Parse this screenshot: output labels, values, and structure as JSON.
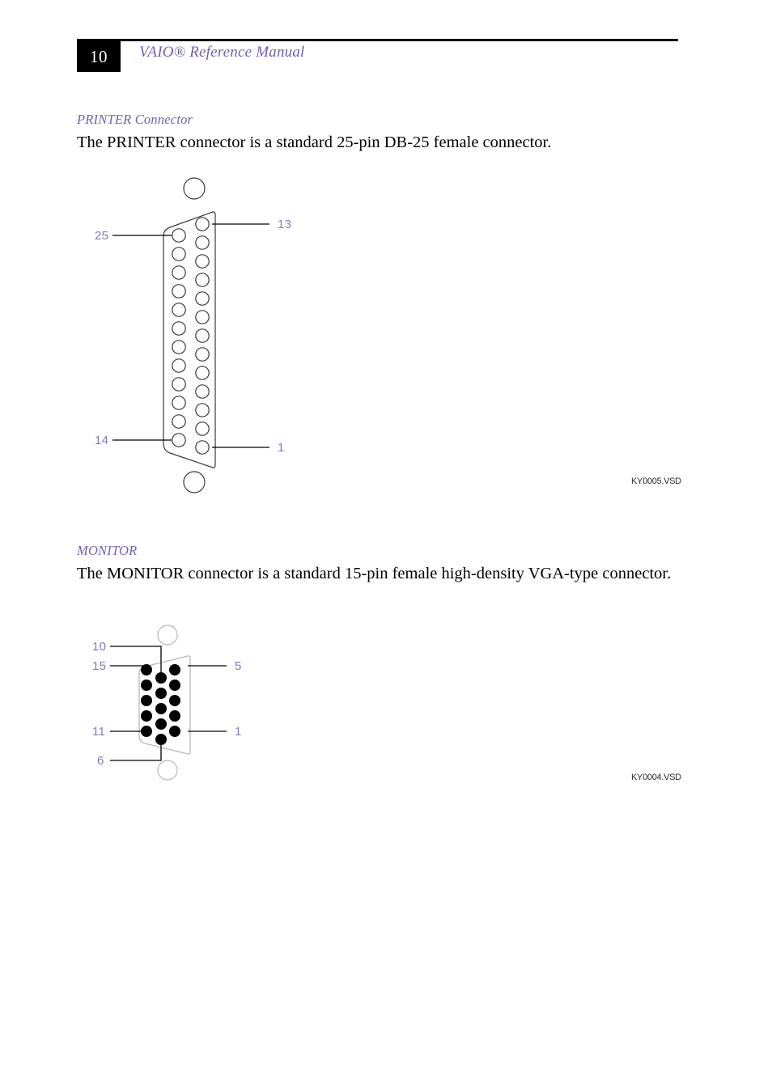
{
  "header": {
    "page_number": "10",
    "title": "VAIO® Reference Manual",
    "accent_color": "#6b63b5"
  },
  "sections": [
    {
      "id": "printer",
      "heading": "PRINTER Connector",
      "body": "The PRINTER connector is a standard 25-pin DB-25 female connector.",
      "figure": {
        "file_label": "KY0005.VSD",
        "connector_type": "DB-25 female",
        "pin_count": 25,
        "pin_style": "open-circle",
        "labels": {
          "top_left": "25",
          "top_right": "13",
          "bottom_left": "14",
          "bottom_right": "1"
        },
        "label_color": "#8079c0",
        "outline_color": "#3a3a3a"
      }
    },
    {
      "id": "monitor",
      "heading": "MONITOR",
      "body": "The MONITOR connector is a standard 15-pin female high-density VGA-type connector.",
      "figure": {
        "file_label": "KY0004.VSD",
        "connector_type": "HD-15 VGA female",
        "pin_count": 15,
        "pin_style": "filled-circle",
        "labels": {
          "upper_middle": "10",
          "upper_left": "15",
          "upper_right": "5",
          "lower_left": "11",
          "lower_right": "1",
          "lower_middle": "6"
        },
        "label_color": "#8079c0",
        "outline_color": "#b8b8b8"
      }
    }
  ]
}
